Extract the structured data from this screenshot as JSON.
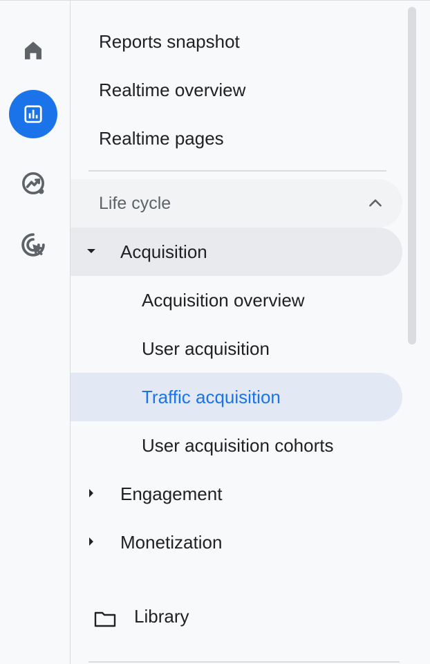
{
  "rail": {
    "items": [
      {
        "icon": "home-icon",
        "active": false
      },
      {
        "icon": "reports-bar-chart-icon",
        "active": true
      },
      {
        "icon": "explore-trend-icon",
        "active": false
      },
      {
        "icon": "advertising-target-cursor-icon",
        "active": false
      }
    ],
    "accent_color": "#1a73e8"
  },
  "nav": {
    "top_items": [
      "Reports snapshot",
      "Realtime overview",
      "Realtime pages"
    ],
    "section": {
      "label": "Life cycle",
      "expanded": true
    },
    "acquisition": {
      "label": "Acquisition",
      "expanded": true,
      "children": [
        {
          "label": "Acquisition overview",
          "selected": false
        },
        {
          "label": "User acquisition",
          "selected": false
        },
        {
          "label": "Traffic acquisition",
          "selected": true
        },
        {
          "label": "User acquisition cohorts",
          "selected": false
        }
      ]
    },
    "engagement": {
      "label": "Engagement",
      "expanded": false
    },
    "monetization": {
      "label": "Monetization",
      "expanded": false
    },
    "library": {
      "label": "Library",
      "icon": "folder-icon"
    },
    "selected_color": "#1a73e8",
    "selected_bg": "#e2e9f5"
  }
}
